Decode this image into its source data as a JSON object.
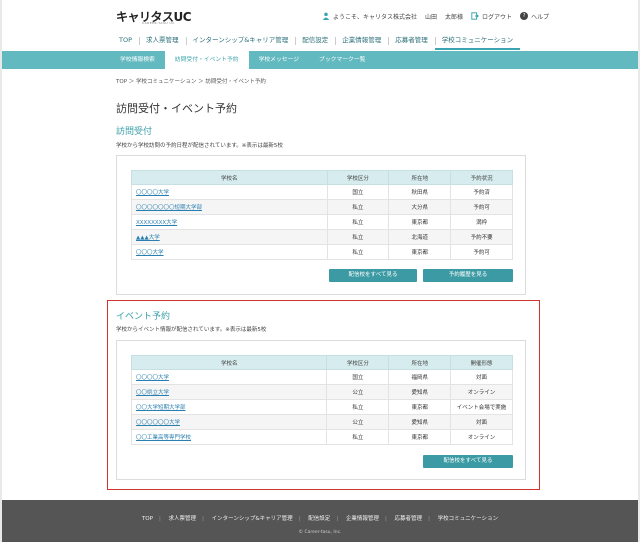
{
  "header": {
    "logo": "キャリタスUC",
    "logo_sub": "CAREER-TASU UC",
    "greeting": "ようこそ、キャリタス株式会社",
    "user_last": "山田",
    "user_first": "太郎様",
    "logout": "ログアウト",
    "help": "ヘルプ"
  },
  "mainnav": [
    "TOP",
    "求人票管理",
    "インターンシップ&キャリア管理",
    "配信設定",
    "企業情報管理",
    "応募者管理",
    "学校コミュニケーション"
  ],
  "subnav": [
    "学校情報検索",
    "訪問受付・イベント予約",
    "学校メッセージ",
    "ブックマーク一覧"
  ],
  "breadcrumb": "TOP ＞ 学校コミュニケーション ＞ 訪問受付・イベント予約",
  "page_title": "訪問受付・イベント予約",
  "visit": {
    "title": "訪問受付",
    "desc": "学校から学校訪問の予約日程が配信されています。※表示は最新5校",
    "headers": [
      "学校名",
      "学校区分",
      "所在地",
      "予約状況"
    ],
    "rows": [
      [
        "〇〇〇〇大学",
        "国立",
        "秋田県",
        "予約済"
      ],
      [
        "〇〇〇〇〇〇〇短期大学部",
        "私立",
        "大分県",
        "予約可"
      ],
      [
        "XXXXXXXX大学",
        "私立",
        "東京都",
        "満枠"
      ],
      [
        "▲▲▲大学",
        "私立",
        "北海道",
        "予約不要"
      ],
      [
        "〇〇〇大学",
        "私立",
        "東京都",
        "予約可"
      ]
    ],
    "btn_all": "配信校をすべて見る",
    "btn_history": "予約履歴を見る"
  },
  "event": {
    "title": "イベント予約",
    "desc": "学校からイベント情報が配信されています。※表示は最新5校",
    "headers": [
      "学校名",
      "学校区分",
      "所在地",
      "開催形態"
    ],
    "rows": [
      [
        "〇〇〇〇大学",
        "国立",
        "福岡県",
        "対面"
      ],
      [
        "〇〇県立大学",
        "公立",
        "愛知県",
        "オンライン"
      ],
      [
        "〇〇大学短期大学部",
        "私立",
        "東京都",
        "イベント会場で実施"
      ],
      [
        "〇〇〇〇〇〇大学",
        "公立",
        "愛知県",
        "対面"
      ],
      [
        "〇〇工業高等専門学校",
        "私立",
        "東京都",
        "オンライン"
      ]
    ],
    "btn_all": "配信校をすべて見る"
  },
  "footer": {
    "links": [
      "TOP",
      "求人票管理",
      "インターンシップ&キャリア管理",
      "配信設定",
      "企業情報管理",
      "応募者管理",
      "学校コミュニケーション"
    ],
    "copyright": "© Career-tasu, Inc."
  },
  "colors": {
    "accent": "#3aa5b0",
    "subnav": "#62b9c0",
    "button": "#3b9aa3",
    "highlight_border": "#d0342c",
    "footer": "#555555"
  }
}
